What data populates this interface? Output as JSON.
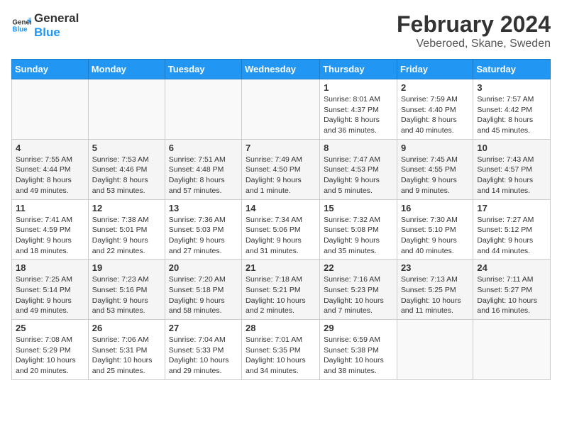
{
  "logo": {
    "line1": "General",
    "line2": "Blue"
  },
  "title": "February 2024",
  "subtitle": "Veberoed, Skane, Sweden",
  "weekdays": [
    "Sunday",
    "Monday",
    "Tuesday",
    "Wednesday",
    "Thursday",
    "Friday",
    "Saturday"
  ],
  "weeks": [
    [
      {
        "day": "",
        "info": ""
      },
      {
        "day": "",
        "info": ""
      },
      {
        "day": "",
        "info": ""
      },
      {
        "day": "",
        "info": ""
      },
      {
        "day": "1",
        "info": "Sunrise: 8:01 AM\nSunset: 4:37 PM\nDaylight: 8 hours\nand 36 minutes."
      },
      {
        "day": "2",
        "info": "Sunrise: 7:59 AM\nSunset: 4:40 PM\nDaylight: 8 hours\nand 40 minutes."
      },
      {
        "day": "3",
        "info": "Sunrise: 7:57 AM\nSunset: 4:42 PM\nDaylight: 8 hours\nand 45 minutes."
      }
    ],
    [
      {
        "day": "4",
        "info": "Sunrise: 7:55 AM\nSunset: 4:44 PM\nDaylight: 8 hours\nand 49 minutes."
      },
      {
        "day": "5",
        "info": "Sunrise: 7:53 AM\nSunset: 4:46 PM\nDaylight: 8 hours\nand 53 minutes."
      },
      {
        "day": "6",
        "info": "Sunrise: 7:51 AM\nSunset: 4:48 PM\nDaylight: 8 hours\nand 57 minutes."
      },
      {
        "day": "7",
        "info": "Sunrise: 7:49 AM\nSunset: 4:50 PM\nDaylight: 9 hours\nand 1 minute."
      },
      {
        "day": "8",
        "info": "Sunrise: 7:47 AM\nSunset: 4:53 PM\nDaylight: 9 hours\nand 5 minutes."
      },
      {
        "day": "9",
        "info": "Sunrise: 7:45 AM\nSunset: 4:55 PM\nDaylight: 9 hours\nand 9 minutes."
      },
      {
        "day": "10",
        "info": "Sunrise: 7:43 AM\nSunset: 4:57 PM\nDaylight: 9 hours\nand 14 minutes."
      }
    ],
    [
      {
        "day": "11",
        "info": "Sunrise: 7:41 AM\nSunset: 4:59 PM\nDaylight: 9 hours\nand 18 minutes."
      },
      {
        "day": "12",
        "info": "Sunrise: 7:38 AM\nSunset: 5:01 PM\nDaylight: 9 hours\nand 22 minutes."
      },
      {
        "day": "13",
        "info": "Sunrise: 7:36 AM\nSunset: 5:03 PM\nDaylight: 9 hours\nand 27 minutes."
      },
      {
        "day": "14",
        "info": "Sunrise: 7:34 AM\nSunset: 5:06 PM\nDaylight: 9 hours\nand 31 minutes."
      },
      {
        "day": "15",
        "info": "Sunrise: 7:32 AM\nSunset: 5:08 PM\nDaylight: 9 hours\nand 35 minutes."
      },
      {
        "day": "16",
        "info": "Sunrise: 7:30 AM\nSunset: 5:10 PM\nDaylight: 9 hours\nand 40 minutes."
      },
      {
        "day": "17",
        "info": "Sunrise: 7:27 AM\nSunset: 5:12 PM\nDaylight: 9 hours\nand 44 minutes."
      }
    ],
    [
      {
        "day": "18",
        "info": "Sunrise: 7:25 AM\nSunset: 5:14 PM\nDaylight: 9 hours\nand 49 minutes."
      },
      {
        "day": "19",
        "info": "Sunrise: 7:23 AM\nSunset: 5:16 PM\nDaylight: 9 hours\nand 53 minutes."
      },
      {
        "day": "20",
        "info": "Sunrise: 7:20 AM\nSunset: 5:18 PM\nDaylight: 9 hours\nand 58 minutes."
      },
      {
        "day": "21",
        "info": "Sunrise: 7:18 AM\nSunset: 5:21 PM\nDaylight: 10 hours\nand 2 minutes."
      },
      {
        "day": "22",
        "info": "Sunrise: 7:16 AM\nSunset: 5:23 PM\nDaylight: 10 hours\nand 7 minutes."
      },
      {
        "day": "23",
        "info": "Sunrise: 7:13 AM\nSunset: 5:25 PM\nDaylight: 10 hours\nand 11 minutes."
      },
      {
        "day": "24",
        "info": "Sunrise: 7:11 AM\nSunset: 5:27 PM\nDaylight: 10 hours\nand 16 minutes."
      }
    ],
    [
      {
        "day": "25",
        "info": "Sunrise: 7:08 AM\nSunset: 5:29 PM\nDaylight: 10 hours\nand 20 minutes."
      },
      {
        "day": "26",
        "info": "Sunrise: 7:06 AM\nSunset: 5:31 PM\nDaylight: 10 hours\nand 25 minutes."
      },
      {
        "day": "27",
        "info": "Sunrise: 7:04 AM\nSunset: 5:33 PM\nDaylight: 10 hours\nand 29 minutes."
      },
      {
        "day": "28",
        "info": "Sunrise: 7:01 AM\nSunset: 5:35 PM\nDaylight: 10 hours\nand 34 minutes."
      },
      {
        "day": "29",
        "info": "Sunrise: 6:59 AM\nSunset: 5:38 PM\nDaylight: 10 hours\nand 38 minutes."
      },
      {
        "day": "",
        "info": ""
      },
      {
        "day": "",
        "info": ""
      }
    ]
  ]
}
